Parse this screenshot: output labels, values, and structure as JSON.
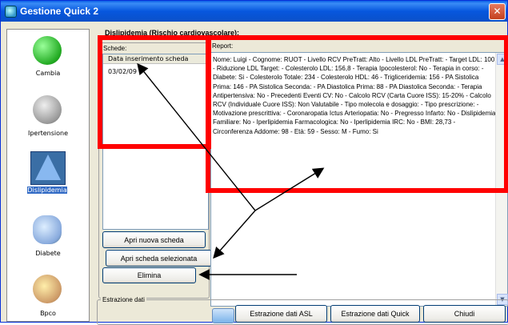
{
  "window": {
    "title": "Gestione Quick 2"
  },
  "sidebar": {
    "items": [
      {
        "label": "Cambia",
        "icon": "refresh-icon"
      },
      {
        "label": "Ipertensione",
        "icon": "stethoscope-icon"
      },
      {
        "label": "Dislipidemia",
        "icon": "drop-icon",
        "selected": true
      },
      {
        "label": "Diabete",
        "icon": "diabetes-icon"
      },
      {
        "label": "Bpco",
        "icon": "lungs-icon"
      }
    ]
  },
  "main": {
    "heading": "Dislipidemia (Rischio cardiovascolare):",
    "schede_label": "Schede:",
    "list_header": "Data inserimento scheda",
    "list_rows": [
      "03/02/09"
    ],
    "report_label": "Report:",
    "report_text": "Nome: Luigi - Cognome: RUOT - Livello RCV PreTratt: Alto - Livello LDL PreTratt: - Target LDL: 100 - Riduzione LDL Target: - Colesterolo LDL: 156,8 - Terapia Ipocolesterol: No - Terapia in corso: - Diabete: Si - Colesterolo Totale: 234 - Colesterolo HDL: 46 - Trigliceridemia: 156 - PA Sistolica Prima: 146 - PA Sistolica Seconda: - PA Diastolica Prima: 88 - PA Diastolica Seconda: - Terapia Antipertensiva: No - Precedenti Eventi CV: No - Calcolo RCV (Carta Cuore ISS): 15-20% - Calcolo RCV (Individuale Cuore ISS): Non Valutabile - Tipo molecola e dosaggio: - Tipo prescrizione: - Motivazione prescrittiva: - Coronaropatia Ictus Arteriopatia: No - Pregresso Infarto: No - Dislipidemia Familiare: No - Iperlipidemia Farmacologica: No - Iperlipidemia IRC: No - BMI: 28,73 - Circonferenza Addome: 98 - Età: 59 - Sesso: M - Fumo: Si",
    "buttons": {
      "new": "Apri nuova scheda",
      "open": "Apri scheda selezionata",
      "delete": "Elimina"
    }
  },
  "extraction": {
    "label": "Estrazione dati",
    "asl": "Estrazione dati ASL",
    "quick": "Estrazione dati Quick",
    "close": "Chiudi"
  },
  "colors": {
    "annotation": "#ff0000",
    "titlebar": "#0a5fe6"
  }
}
